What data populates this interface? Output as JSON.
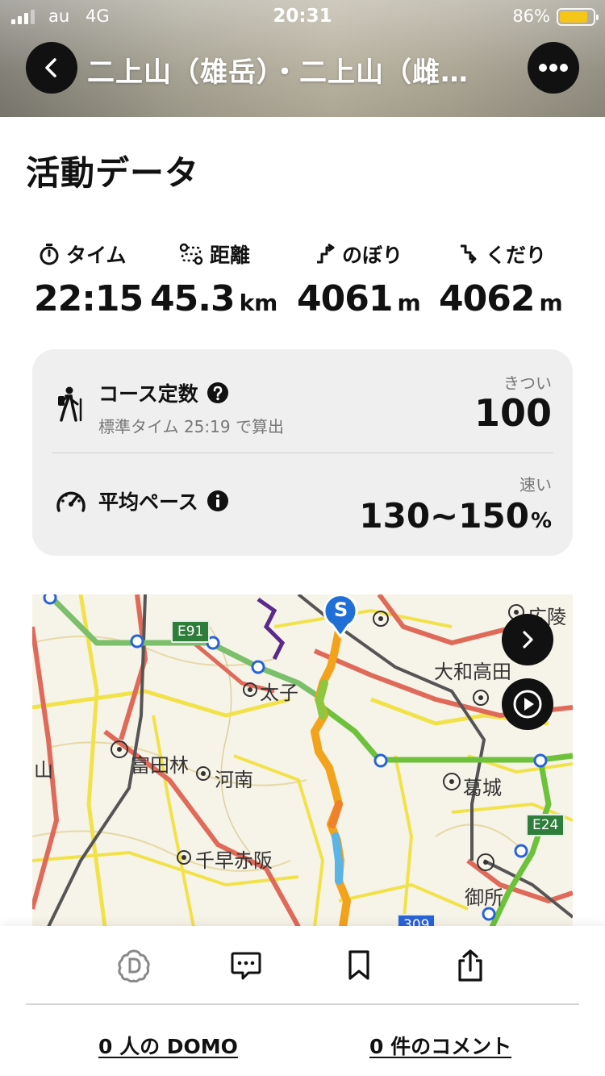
{
  "status_bar": {
    "carrier": "au",
    "network": "4G",
    "time": "20:31",
    "battery_percent": "86%",
    "battery_level": 0.86
  },
  "header": {
    "title": "二上山（雄岳）・二上山（雌…",
    "back_icon": "chevron-left-icon",
    "more_icon": "ellipsis-icon"
  },
  "section_title": "活動データ",
  "stats": [
    {
      "icon": "stopwatch-icon",
      "label": "タイム",
      "value": "22:15",
      "unit": ""
    },
    {
      "icon": "route-icon",
      "label": "距離",
      "value": "45.3",
      "unit": "km"
    },
    {
      "icon": "ascent-icon",
      "label": "のぼり",
      "value": "4061",
      "unit": "m"
    },
    {
      "icon": "descent-icon",
      "label": "くだり",
      "value": "4062",
      "unit": "m"
    }
  ],
  "course_constant": {
    "title": "コース定数",
    "subtitle": "標準タイム 25:19 で算出",
    "tag": "きつい",
    "value": "100",
    "icon": "hiker-icon",
    "help_icon": "question-icon"
  },
  "average_pace": {
    "title": "平均ペース",
    "tag": "速い",
    "value": "130~150",
    "unit": "%",
    "icon": "speedometer-icon",
    "info_icon": "info-icon"
  },
  "map": {
    "labels": [
      "広陵",
      "大和高田",
      "太子",
      "富田林",
      "河南",
      "葛城",
      "千早赤阪",
      "御所",
      "山"
    ],
    "shields": [
      "E91",
      "E24",
      "309"
    ],
    "start_marker": "S",
    "colors": {
      "route_orange": "#f3a21b",
      "route_green": "#8dc63f",
      "road_red": "#e06a5a",
      "road_yellow": "#f2e24a",
      "rail_blue": "#2a62d8"
    }
  },
  "bottom": {
    "icons": [
      "domo-icon",
      "comment-icon",
      "bookmark-icon",
      "share-icon"
    ],
    "domo_link": "0 人の DOMO",
    "comment_link": "0 件のコメント"
  }
}
